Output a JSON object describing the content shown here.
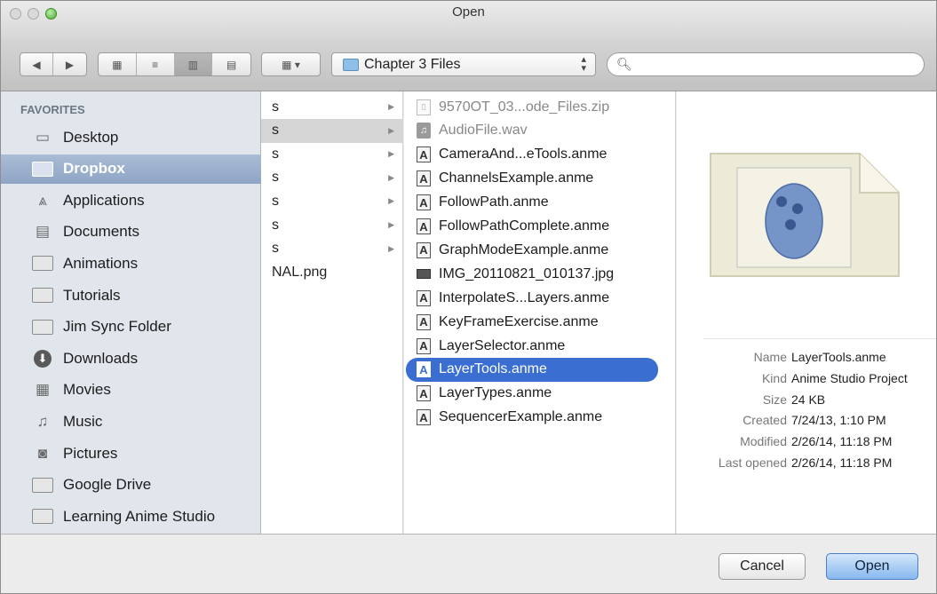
{
  "window": {
    "title": "Open"
  },
  "toolbar": {
    "nav_back_icon": "◀",
    "nav_forward_icon": "▶",
    "view_icons": [
      "▦",
      "≡",
      "▥",
      "▤"
    ],
    "arrange_icon": "▦ ▾",
    "path_label": "Chapter 3 Files",
    "search": {
      "value": "",
      "placeholder": ""
    }
  },
  "sidebar": {
    "header": "FAVORITES",
    "items": [
      {
        "label": "Desktop",
        "icon": "desktop-icon"
      },
      {
        "label": "Dropbox",
        "icon": "folder-icon",
        "selected": true
      },
      {
        "label": "Applications",
        "icon": "applications-icon"
      },
      {
        "label": "Documents",
        "icon": "documents-icon"
      },
      {
        "label": "Animations",
        "icon": "folder-icon"
      },
      {
        "label": "Tutorials",
        "icon": "folder-icon"
      },
      {
        "label": "Jim Sync Folder",
        "icon": "folder-icon"
      },
      {
        "label": "Downloads",
        "icon": "downloads-icon"
      },
      {
        "label": "Movies",
        "icon": "movies-icon"
      },
      {
        "label": "Music",
        "icon": "music-icon"
      },
      {
        "label": "Pictures",
        "icon": "pictures-icon"
      },
      {
        "label": "Google Drive",
        "icon": "folder-icon"
      },
      {
        "label": "Learning Anime Studio",
        "icon": "folder-icon"
      }
    ]
  },
  "column1": {
    "items": [
      {
        "label": "s",
        "arrow": true
      },
      {
        "label": "s",
        "arrow": true,
        "selected": true
      },
      {
        "label": "s",
        "arrow": true
      },
      {
        "label": "s",
        "arrow": true
      },
      {
        "label": "s",
        "arrow": true
      },
      {
        "label": "s",
        "arrow": true
      },
      {
        "label": "s",
        "arrow": true
      },
      {
        "label": "NAL.png",
        "arrow": false
      }
    ]
  },
  "column2": {
    "items": [
      {
        "label": "9570OT_03...ode_Files.zip",
        "type": "zip",
        "dim": true
      },
      {
        "label": "AudioFile.wav",
        "type": "audio",
        "dim": true
      },
      {
        "label": "CameraAnd...eTools.anme",
        "type": "anme"
      },
      {
        "label": "ChannelsExample.anme",
        "type": "anme"
      },
      {
        "label": "FollowPath.anme",
        "type": "anme"
      },
      {
        "label": "FollowPathComplete.anme",
        "type": "anme"
      },
      {
        "label": "GraphModeExample.anme",
        "type": "anme"
      },
      {
        "label": "IMG_20110821_010137.jpg",
        "type": "img"
      },
      {
        "label": "InterpolateS...Layers.anme",
        "type": "anme"
      },
      {
        "label": "KeyFrameExercise.anme",
        "type": "anme"
      },
      {
        "label": "LayerSelector.anme",
        "type": "anme"
      },
      {
        "label": "LayerTools.anme",
        "type": "anme",
        "selected": true
      },
      {
        "label": "LayerTypes.anme",
        "type": "anme"
      },
      {
        "label": "SequencerExample.anme",
        "type": "anme"
      }
    ]
  },
  "preview": {
    "info": [
      {
        "key": "Name",
        "value": "LayerTools.anme"
      },
      {
        "key": "Kind",
        "value": "Anime Studio Project"
      },
      {
        "key": "Size",
        "value": "24 KB"
      },
      {
        "key": "Created",
        "value": "7/24/13, 1:10 PM"
      },
      {
        "key": "Modified",
        "value": "2/26/14, 11:18 PM"
      },
      {
        "key": "Last opened",
        "value": "2/26/14, 11:18 PM"
      }
    ]
  },
  "buttons": {
    "cancel": "Cancel",
    "open": "Open"
  },
  "colors": {
    "selection": "#3a6fd1",
    "sidebar_selection": "#98adc9",
    "sidebar_bg": "#e1e6ec"
  }
}
